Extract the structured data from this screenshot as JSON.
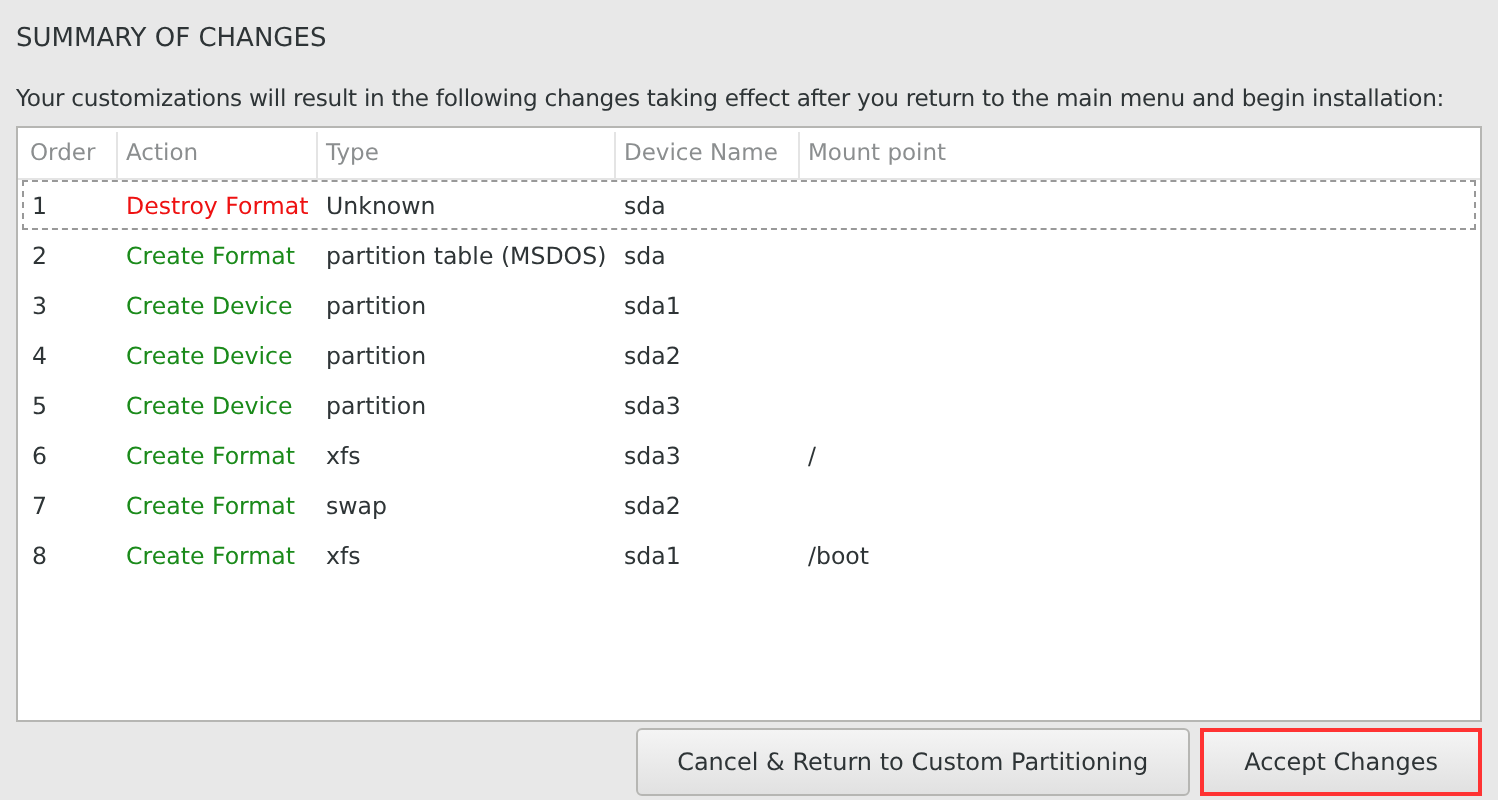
{
  "section_title": "SUMMARY OF CHANGES",
  "description": "Your customizations will result in the following changes taking effect after you return to the main menu and begin installation:",
  "table": {
    "columns": [
      "Order",
      "Action",
      "Type",
      "Device Name",
      "Mount point"
    ],
    "rows": [
      {
        "order": "1",
        "action": "Destroy Format",
        "kind": "destroy",
        "type": "Unknown",
        "device": "sda",
        "mount": "",
        "focused": true
      },
      {
        "order": "2",
        "action": "Create Format",
        "kind": "create",
        "type": "partition table (MSDOS)",
        "device": "sda",
        "mount": "",
        "focused": false
      },
      {
        "order": "3",
        "action": "Create Device",
        "kind": "create",
        "type": "partition",
        "device": "sda1",
        "mount": "",
        "focused": false
      },
      {
        "order": "4",
        "action": "Create Device",
        "kind": "create",
        "type": "partition",
        "device": "sda2",
        "mount": "",
        "focused": false
      },
      {
        "order": "5",
        "action": "Create Device",
        "kind": "create",
        "type": "partition",
        "device": "sda3",
        "mount": "",
        "focused": false
      },
      {
        "order": "6",
        "action": "Create Format",
        "kind": "create",
        "type": "xfs",
        "device": "sda3",
        "mount": "/",
        "focused": false
      },
      {
        "order": "7",
        "action": "Create Format",
        "kind": "create",
        "type": "swap",
        "device": "sda2",
        "mount": "",
        "focused": false
      },
      {
        "order": "8",
        "action": "Create Format",
        "kind": "create",
        "type": "xfs",
        "device": "sda1",
        "mount": "/boot",
        "focused": false
      }
    ]
  },
  "buttons": [
    {
      "label": "Cancel & Return to Custom Partitioning",
      "highlighted": false
    },
    {
      "label": "Accept Changes",
      "highlighted": true
    }
  ]
}
